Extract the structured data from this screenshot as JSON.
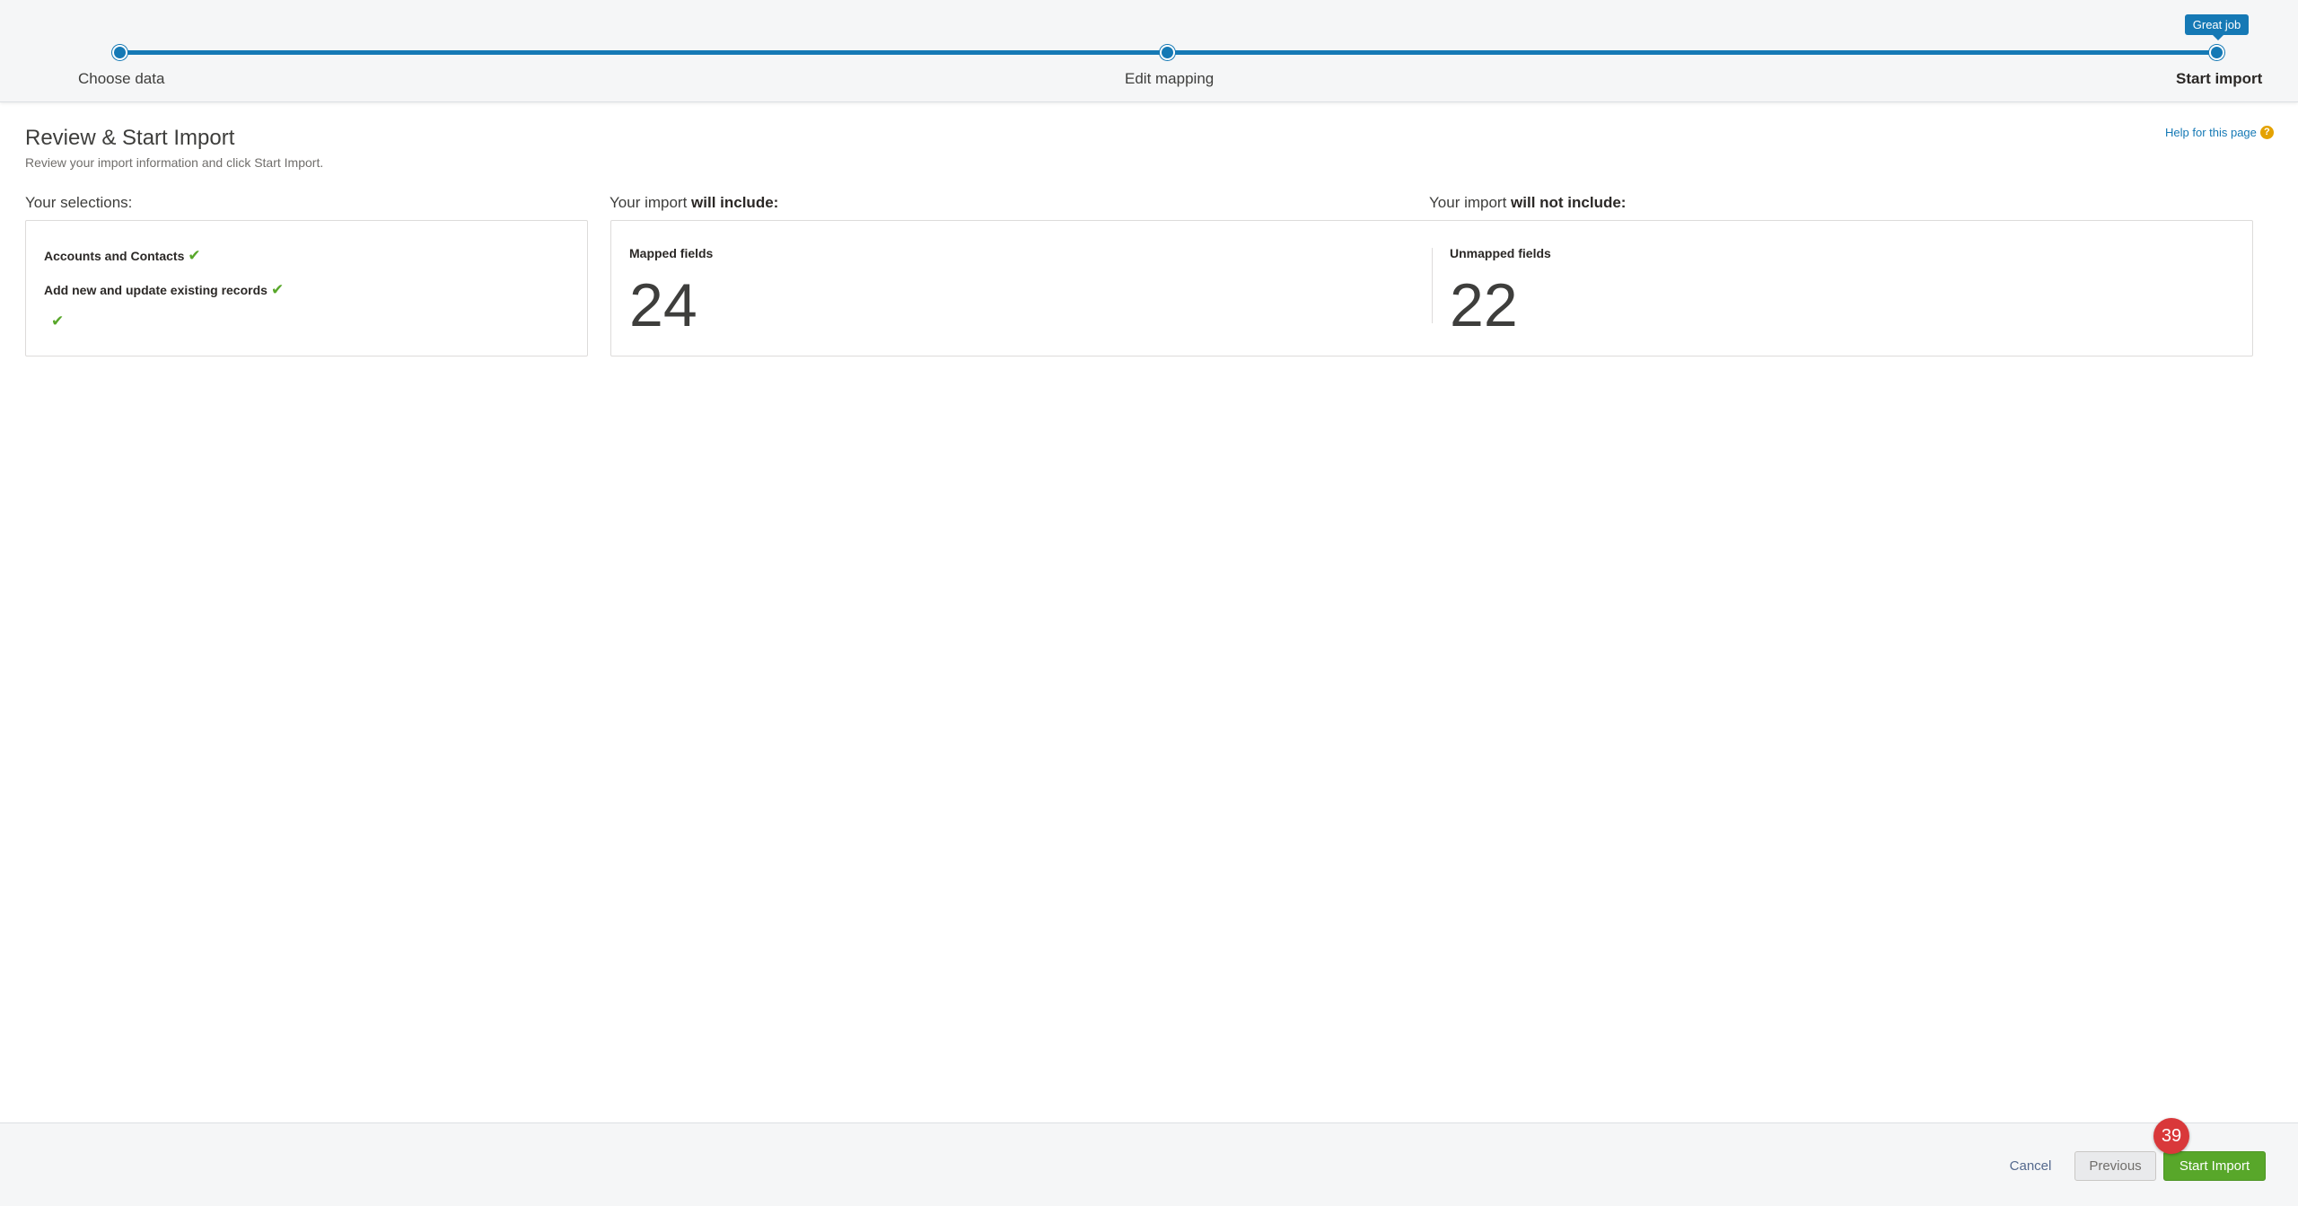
{
  "wizard": {
    "steps": [
      {
        "label": "Choose data"
      },
      {
        "label": "Edit mapping"
      },
      {
        "label": "Start import"
      }
    ],
    "tooltip": "Great job",
    "accent_color": "#1579b5"
  },
  "page": {
    "title": "Review & Start Import",
    "subtitle": "Review your import information and click Start Import.",
    "help_link": "Help for this page",
    "help_icon": "question-icon"
  },
  "selections": {
    "heading": "Your selections:",
    "items": [
      {
        "label": "Accounts and Contacts",
        "icon": "check-icon"
      },
      {
        "label": "Add new and update existing records",
        "icon": "check-icon"
      },
      {
        "label": "",
        "icon": "check-icon"
      }
    ],
    "check_color": "#58a72a"
  },
  "include": {
    "heading_prefix": "Your import ",
    "heading_bold": "will include:",
    "mapped_label": "Mapped fields",
    "mapped_value": "24"
  },
  "exclude": {
    "heading_prefix": "Your import ",
    "heading_bold": "will not include:",
    "unmapped_label": "Unmapped fields",
    "unmapped_value": "22"
  },
  "footer": {
    "cancel_label": "Cancel",
    "previous_label": "Previous",
    "start_label": "Start Import",
    "badge_count": "39",
    "start_color": "#58a72a",
    "badge_color": "#d9383a"
  }
}
